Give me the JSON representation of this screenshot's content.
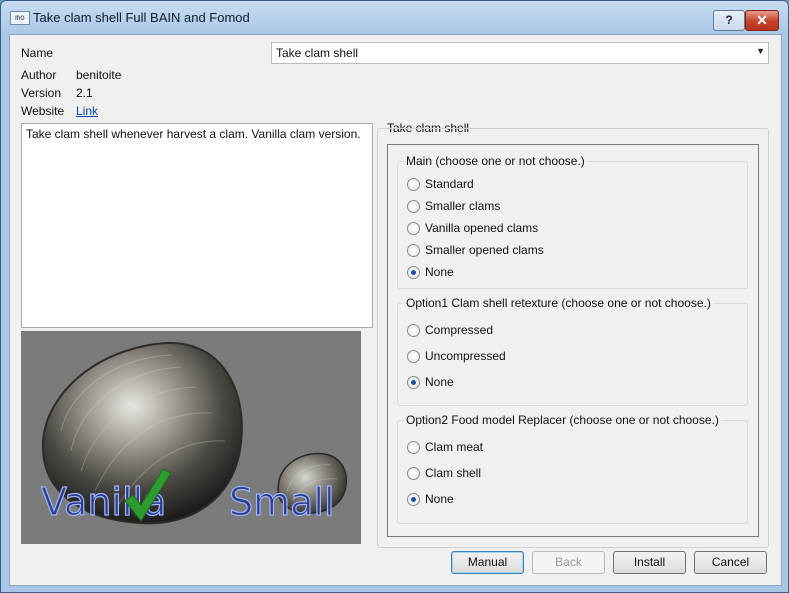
{
  "window": {
    "title": "Take clam shell Full BAIN and Fomod",
    "app_icon_text": "mo",
    "help_label": "?",
    "close_label": "✕"
  },
  "info": {
    "name_label": "Name",
    "name_value": "Take clam shell",
    "author_label": "Author",
    "author_value": "benitoite",
    "version_label": "Version",
    "version_value": "2.1",
    "website_label": "Website",
    "website_link": "Link"
  },
  "description": "Take clam shell whenever harvest a clam. Vanilla clam version.",
  "preview": {
    "vanilla_text": "Vanilla",
    "small_text": "Small"
  },
  "step_title": "Take clam shell",
  "groups": [
    {
      "title": "Main (choose one or not choose.)",
      "options": [
        {
          "label": "Standard",
          "selected": false
        },
        {
          "label": "Smaller clams",
          "selected": false
        },
        {
          "label": "Vanilla opened clams",
          "selected": false
        },
        {
          "label": "Smaller opened clams",
          "selected": false
        },
        {
          "label": "None",
          "selected": true
        }
      ]
    },
    {
      "title": "Option1 Clam shell retexture (choose one or not choose.)",
      "options": [
        {
          "label": "Compressed",
          "selected": false
        },
        {
          "label": "Uncompressed",
          "selected": false
        },
        {
          "label": "None",
          "selected": true
        }
      ]
    },
    {
      "title": "Option2 Food model Replacer (choose one or not choose.)",
      "options": [
        {
          "label": "Clam meat",
          "selected": false
        },
        {
          "label": "Clam shell",
          "selected": false
        },
        {
          "label": "None",
          "selected": true
        }
      ]
    }
  ],
  "buttons": {
    "manual": "Manual",
    "back": "Back",
    "install": "Install",
    "cancel": "Cancel"
  }
}
